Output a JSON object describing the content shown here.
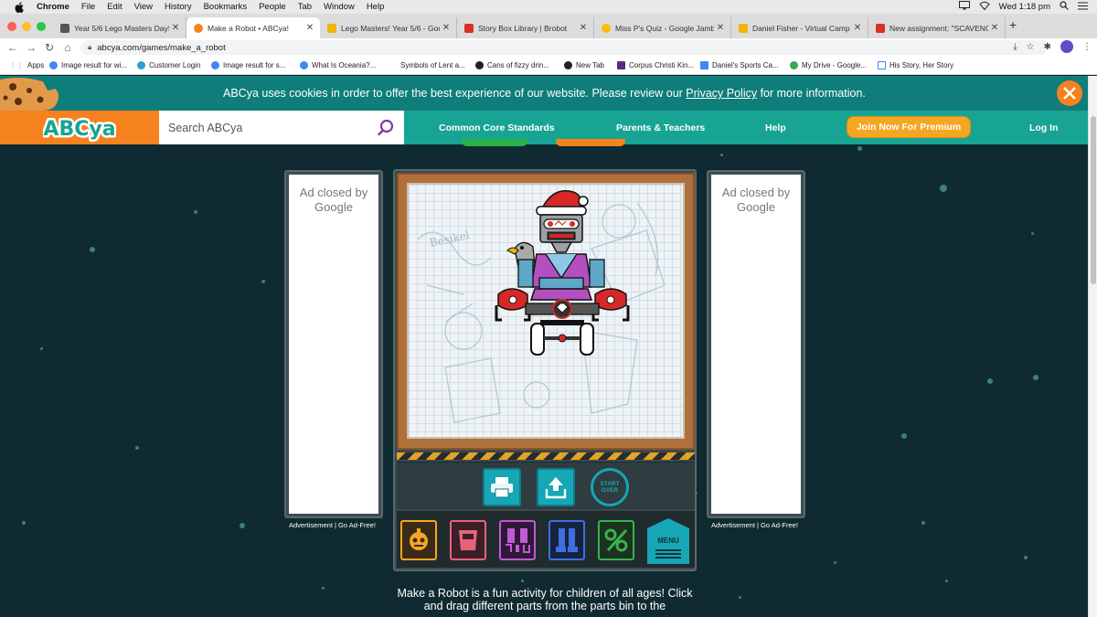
{
  "menubar": {
    "app": "Chrome",
    "items": [
      "File",
      "Edit",
      "View",
      "History",
      "Bookmarks",
      "People",
      "Tab",
      "Window",
      "Help"
    ],
    "clock": "Wed 1:18 pm"
  },
  "tabs": [
    {
      "title": "Year 5/6 Lego Masters Day!",
      "color": "#555555"
    },
    {
      "title": "Make a Robot • ABCya!",
      "color": "#f5821f",
      "active": true
    },
    {
      "title": "Lego Masters! Year 5/6 - Goog",
      "color": "#f4b400"
    },
    {
      "title": "Story Box Library | Brobot",
      "color": "#d93025"
    },
    {
      "title": "Miss P's Quiz - Google Jambo",
      "color": "#fbbc04"
    },
    {
      "title": "Daniel Fisher - Virtual Camp Jo",
      "color": "#f4b400"
    },
    {
      "title": "New assignment: \"SCAVENGE",
      "color": "#d93025"
    }
  ],
  "address": {
    "url": "abcya.com/games/make_a_robot"
  },
  "bookmarks": [
    "Apps",
    "Image result for wi...",
    "Customer Login",
    "Image result for s...",
    "What Is Oceania?...",
    "Symbols of Lent a...",
    "Cans of fizzy drin...",
    "New Tab",
    "Corpus Christi Kin...",
    "Daniel's Sports Ca...",
    "My Drive - Google...",
    "His Story, Her Story"
  ],
  "cookie": {
    "before": "ABCya uses cookies in order to offer the best experience of our website. Please review our ",
    "link": "Privacy Policy",
    "after": " for more information."
  },
  "site": {
    "logo": "ABCya",
    "search_placeholder": "Search ABCya",
    "nav": [
      "Common Core Standards",
      "Parents & Teachers",
      "Help"
    ],
    "premium": "Join Now For Premium",
    "login": "Log In"
  },
  "ads": {
    "closed_line1": "Ad closed by",
    "closed_line2": "Google",
    "caption": "Advertisement | Go Ad-Free!"
  },
  "game": {
    "start_over_line1": "START",
    "start_over_line2": "OVER",
    "menu_label": "MENU",
    "description": "Make a Robot is a fun activity for children of all ages! Click and drag different parts from the parts bin to the"
  }
}
